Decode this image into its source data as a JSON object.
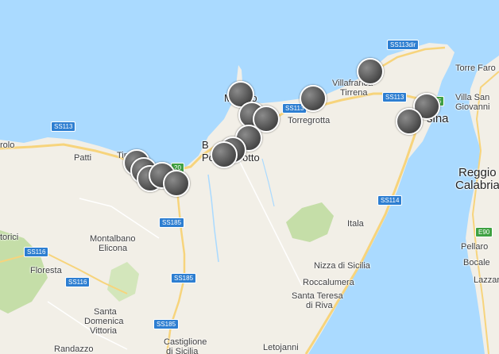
{
  "map": {
    "colors": {
      "sea": "#aadaff",
      "land": "#f2efe7",
      "green": "#c5dea8",
      "highway": "#f7d47c",
      "road": "#ffffff",
      "river": "#aadaff",
      "marker_bg": "#3a3a3a"
    },
    "places": [
      {
        "id": "patti",
        "text": "Patti"
      },
      {
        "id": "tindari",
        "text": "Tin"
      },
      {
        "id": "rolo",
        "text": "rolo"
      },
      {
        "id": "milazzo_a",
        "text": "M"
      },
      {
        "id": "milazzo_b",
        "text": "zio"
      },
      {
        "id": "barcellona",
        "text": "B"
      },
      {
        "id": "pozzo_a",
        "text": "Pozz"
      },
      {
        "id": "pozzo_b",
        "text": "otto"
      },
      {
        "id": "torregrotta",
        "text": "Torregrotta"
      },
      {
        "id": "villafranca_1",
        "text": "Villafranca"
      },
      {
        "id": "villafranca_2",
        "text": "Tirrena"
      },
      {
        "id": "torre_faro",
        "text": "Torre Faro"
      },
      {
        "id": "villa_sg_1",
        "text": "Villa San"
      },
      {
        "id": "villa_sg_2",
        "text": "Giovanni"
      },
      {
        "id": "messina",
        "text": "sina"
      },
      {
        "id": "reggio_1",
        "text": "Reggio"
      },
      {
        "id": "reggio_2",
        "text": "Calabria"
      },
      {
        "id": "italia",
        "text": "Itala"
      },
      {
        "id": "pellaro",
        "text": "Pellaro"
      },
      {
        "id": "bocale",
        "text": "Bocale"
      },
      {
        "id": "lazzaro",
        "text": "Lazzar"
      },
      {
        "id": "torici",
        "text": "torici"
      },
      {
        "id": "montalbano_1",
        "text": "Montalbano"
      },
      {
        "id": "montalbano_2",
        "text": "Elicona"
      },
      {
        "id": "floresta",
        "text": "Floresta"
      },
      {
        "id": "nizza",
        "text": "Nizza di Sicilia"
      },
      {
        "id": "roccalumera",
        "text": "Roccalumera"
      },
      {
        "id": "santa_teresa_1",
        "text": "Santa Teresa"
      },
      {
        "id": "santa_teresa_2",
        "text": "di Riva"
      },
      {
        "id": "santa_dom_1",
        "text": "Santa"
      },
      {
        "id": "santa_dom_2",
        "text": "Domenica"
      },
      {
        "id": "santa_dom_3",
        "text": "Vittoria"
      },
      {
        "id": "randazzo",
        "text": "Randazzo"
      },
      {
        "id": "castiglione_1",
        "text": "Castiglione"
      },
      {
        "id": "castiglione_2",
        "text": "di Sicilia"
      },
      {
        "id": "letojanni",
        "text": "Letojanni"
      }
    ],
    "shields": [
      {
        "id": "ss113dir",
        "text": "SS113dir"
      },
      {
        "id": "ss113_w",
        "text": "SS113"
      },
      {
        "id": "ss113_c",
        "text": "SS113"
      },
      {
        "id": "ss113_e",
        "text": "SS113"
      },
      {
        "id": "e90",
        "text": "E90"
      },
      {
        "id": "ss114",
        "text": "SS114"
      },
      {
        "id": "ss185_a",
        "text": "SS185"
      },
      {
        "id": "ss185_b",
        "text": "SS185"
      },
      {
        "id": "ss185_c",
        "text": "SS185"
      },
      {
        "id": "ss116_a",
        "text": "SS116"
      },
      {
        "id": "ss116_b",
        "text": "SS116"
      },
      {
        "id": "a20_num",
        "text": "20"
      },
      {
        "id": "a18_num",
        "text": "5"
      }
    ]
  }
}
